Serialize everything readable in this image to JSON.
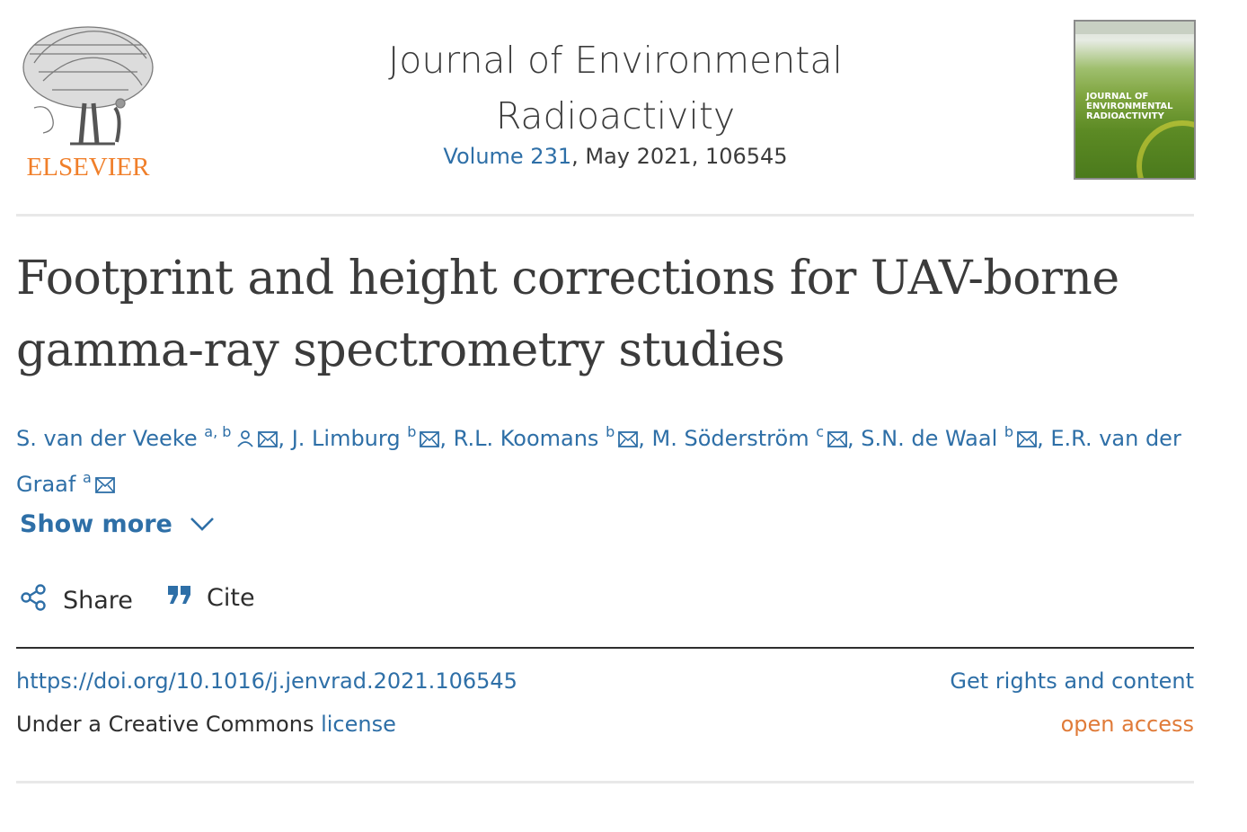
{
  "header": {
    "publisher": "ELSEVIER",
    "journal_title_line1": "Journal of Environmental",
    "journal_title_line2": "Radioactivity",
    "volume_link": "Volume 231",
    "issue_rest": ", May 2021, 106545",
    "cover_text": "JOURNAL OF ENVIRONMENTAL RADIOACTIVITY"
  },
  "article": {
    "title": "Footprint and height corrections for UAV-borne gamma-ray spectrometry studies"
  },
  "authors": [
    {
      "name": "S. van der Veeke",
      "aff": "a, b",
      "has_person_icon": true
    },
    {
      "name": "J. Limburg",
      "aff": "b"
    },
    {
      "name": "R.L. Koomans",
      "aff": "b"
    },
    {
      "name": "M. Söderström",
      "aff": "c"
    },
    {
      "name": "S.N. de Waal",
      "aff": "b"
    },
    {
      "name": "E.R. van der Graaf",
      "aff": "a"
    }
  ],
  "actions": {
    "show_more": "Show more",
    "share": "Share",
    "cite": "Cite"
  },
  "meta": {
    "doi": "https://doi.org/10.1016/j.jenvrad.2021.106545",
    "rights": "Get rights and content",
    "license_prefix": "Under a Creative Commons ",
    "license_link": "license",
    "access": "open access"
  },
  "colors": {
    "link_blue": "#2e6fa7",
    "elsevier_orange": "#f07f2a",
    "open_access_orange": "#e07b39"
  }
}
